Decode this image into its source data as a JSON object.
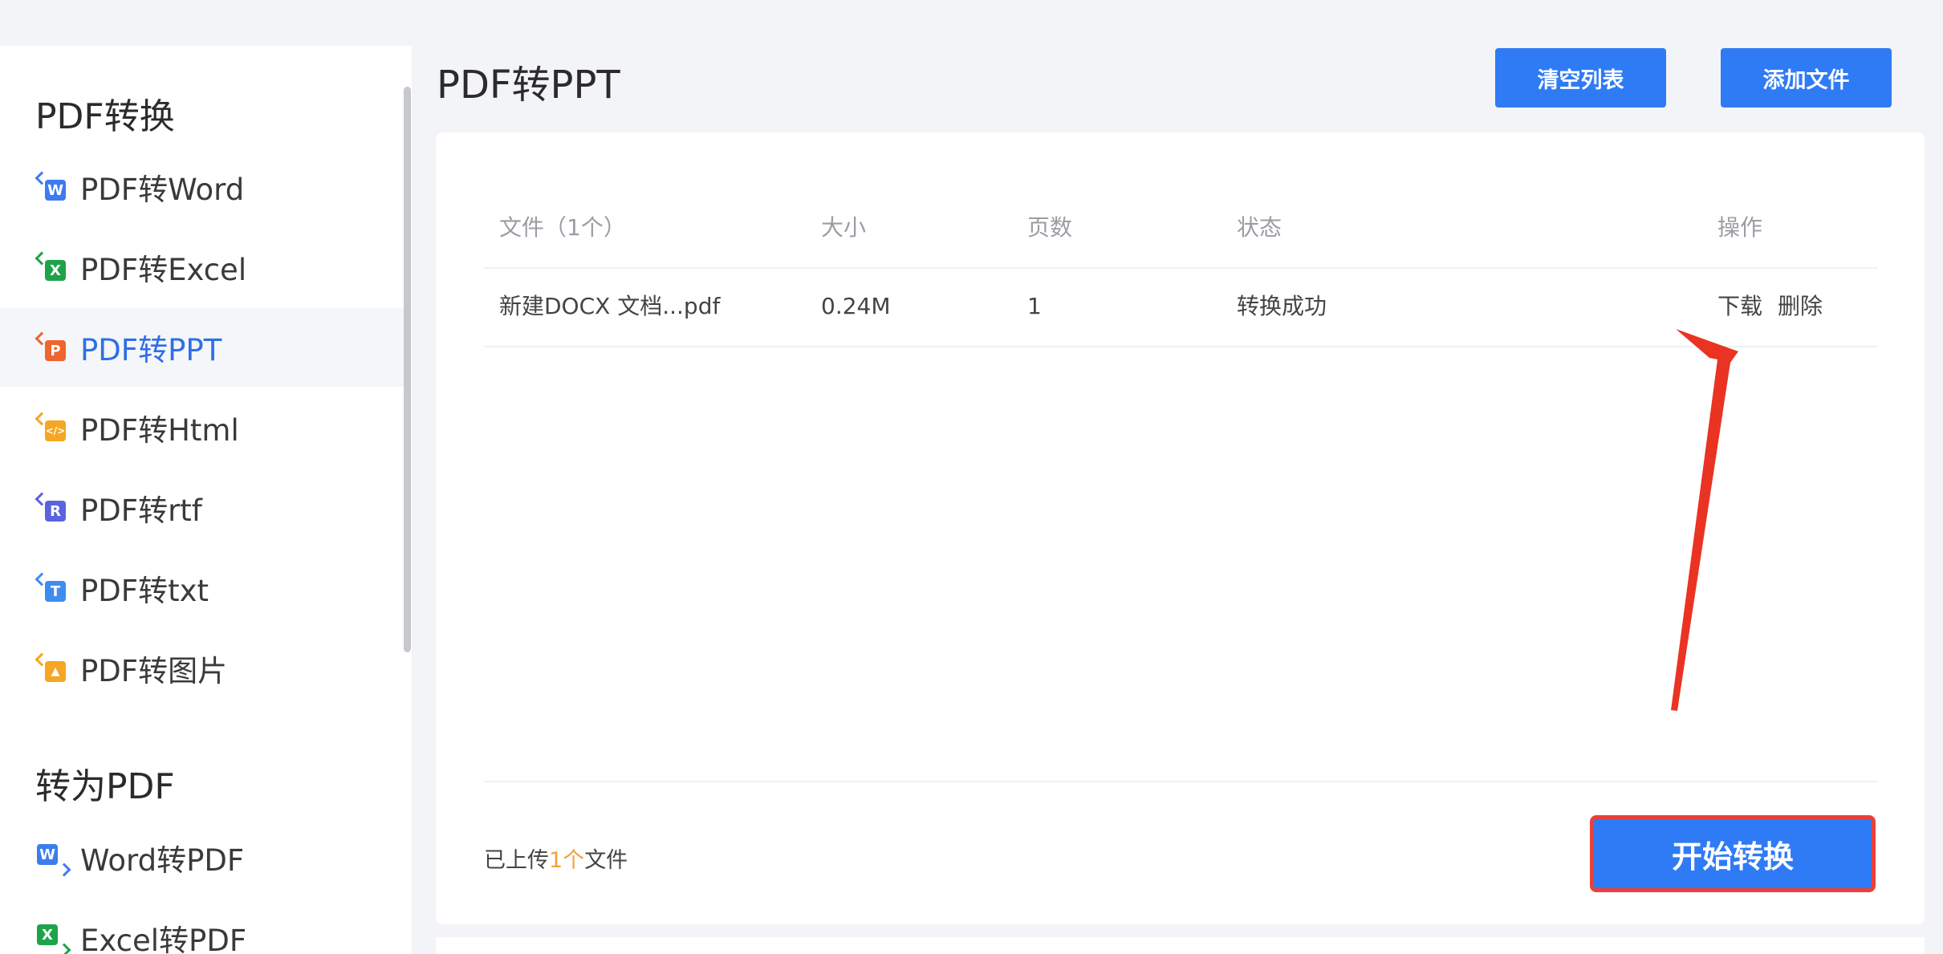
{
  "sidebar": {
    "section1_title": "PDF转换",
    "section2_title": "转为PDF",
    "items": [
      {
        "label": "PDF转Word",
        "glyph": "W",
        "color": "#3d7cf0"
      },
      {
        "label": "PDF转Excel",
        "glyph": "X",
        "color": "#1fa34a"
      },
      {
        "label": "PDF转PPT",
        "glyph": "P",
        "color": "#f0642d"
      },
      {
        "label": "PDF转Html",
        "glyph": "</>",
        "color": "#f5a623"
      },
      {
        "label": "PDF转rtf",
        "glyph": "R",
        "color": "#5b63e0"
      },
      {
        "label": "PDF转txt",
        "glyph": "T",
        "color": "#3d8df0"
      },
      {
        "label": "PDF转图片",
        "glyph": "▲",
        "color": "#f5a623"
      }
    ],
    "items2": [
      {
        "label": "Word转PDF",
        "glyph": "W",
        "color": "#3d7cf0"
      },
      {
        "label": "Excel转PDF",
        "glyph": "X",
        "color": "#1fa34a"
      }
    ]
  },
  "header": {
    "title": "PDF转PPT",
    "clear_label": "清空列表",
    "add_label": "添加文件"
  },
  "table": {
    "columns": [
      "文件（1个）",
      "大小",
      "页数",
      "状态",
      "操作"
    ],
    "rows": [
      {
        "name": "新建DOCX 文档...pdf",
        "size": "0.24M",
        "pages": "1",
        "status": "转换成功",
        "download": "下载",
        "delete": "删除"
      }
    ]
  },
  "footer": {
    "prefix": "已上传",
    "count": "1个",
    "suffix": "文件",
    "start_label": "开始转换"
  },
  "colors": {
    "accent": "#2f7bf5",
    "highlight": "#e8403a",
    "count": "#f2a23a"
  }
}
